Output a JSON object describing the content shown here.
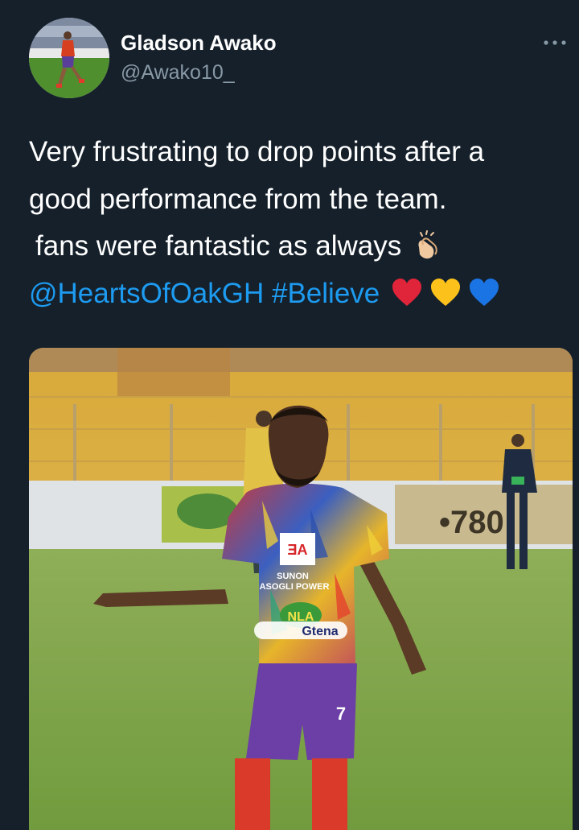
{
  "tweet": {
    "author": {
      "display_name": "Gladson Awako",
      "handle": "@Awako10_",
      "avatar": "avatar-photo"
    },
    "more_icon": "more-horizontal-icon",
    "text_lines": [
      "Very frustrating to drop points after a",
      "good performance from the team.",
      "fans were fantastic as always"
    ],
    "mention": "@HeartsOfOakGH",
    "hashtag": "#Believe",
    "emojis": [
      "clapping-hands-emoji",
      "red-heart-emoji",
      "yellow-heart-emoji",
      "blue-heart-emoji"
    ],
    "media": {
      "type": "photo",
      "jersey_text": [
        "SUNON",
        "ASOGLI POWER",
        "NLA",
        "Gtena"
      ],
      "jersey_number": "7",
      "board_text": "780"
    }
  },
  "colors": {
    "background": "#15202b",
    "text": "#ffffff",
    "secondary_text": "#8899a6",
    "link": "#1d9bf0"
  }
}
